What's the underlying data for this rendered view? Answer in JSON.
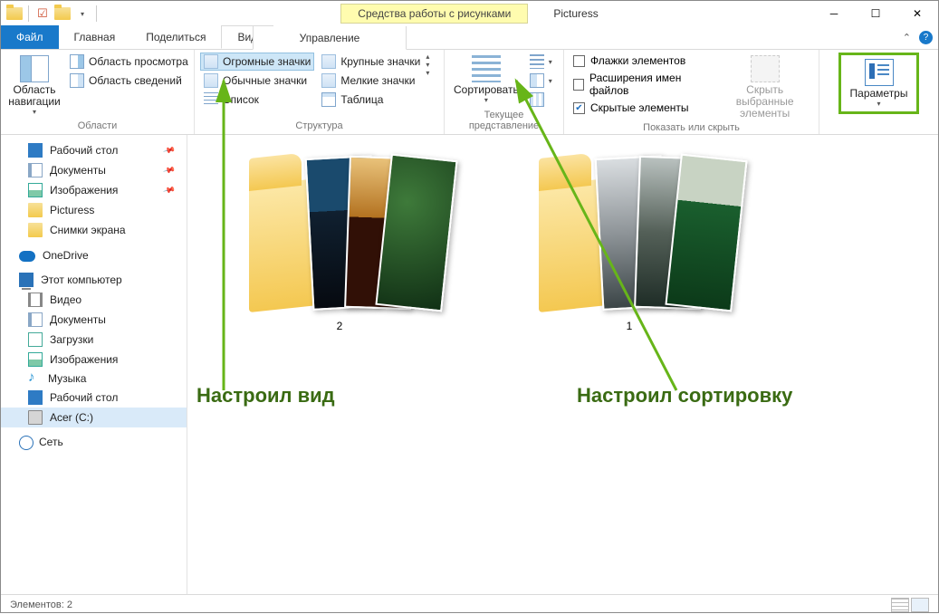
{
  "titlebar": {
    "context_tab": "Средства работы с рисунками",
    "app_title": "Picturess"
  },
  "tabs": {
    "file": "Файл",
    "home": "Главная",
    "share": "Поделиться",
    "view": "Вид",
    "manage": "Управление"
  },
  "ribbon": {
    "panes": {
      "nav_pane": "Область\nнавигации",
      "preview": "Область просмотра",
      "details": "Область сведений",
      "group": "Области"
    },
    "layout": {
      "extra_large": "Огромные значки",
      "large": "Крупные значки",
      "medium": "Обычные значки",
      "small": "Мелкие значки",
      "list": "Список",
      "table": "Таблица",
      "group": "Структура"
    },
    "current": {
      "sort": "Сортировать",
      "group": "Текущее представление"
    },
    "show": {
      "checkboxes": "Флажки элементов",
      "extensions": "Расширения имен файлов",
      "hidden": "Скрытые элементы",
      "hide_selected": "Скрыть выбранные\nэлементы",
      "group": "Показать или скрыть"
    },
    "options": {
      "label": "Параметры"
    }
  },
  "nav": {
    "desktop": "Рабочий стол",
    "documents": "Документы",
    "pictures": "Изображения",
    "picturess": "Picturess",
    "screenshots": "Снимки экрана",
    "onedrive": "OneDrive",
    "this_pc": "Этот компьютер",
    "videos": "Видео",
    "documents2": "Документы",
    "downloads": "Загрузки",
    "pictures2": "Изображения",
    "music": "Музыка",
    "desktop2": "Рабочий стол",
    "disk_c": "Acer (C:)",
    "network": "Сеть"
  },
  "folders": [
    {
      "name": "2"
    },
    {
      "name": "1"
    }
  ],
  "status": {
    "items": "Элементов: 2"
  },
  "annotations": {
    "view": "Настроил вид",
    "sort": "Настроил сортировку"
  }
}
